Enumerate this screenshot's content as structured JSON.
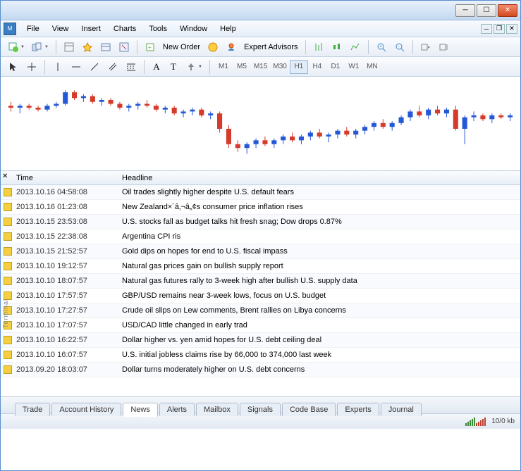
{
  "menu": [
    "File",
    "View",
    "Insert",
    "Charts",
    "Tools",
    "Window",
    "Help"
  ],
  "toolbar_labels": {
    "new_order": "New Order",
    "expert_advisors": "Expert Advisors"
  },
  "timeframes": [
    "M1",
    "M5",
    "M15",
    "M30",
    "H1",
    "H4",
    "D1",
    "W1",
    "MN"
  ],
  "active_timeframe": "H1",
  "news_columns": {
    "time": "Time",
    "headline": "Headline"
  },
  "news": [
    {
      "time": "2013.10.16 04:58:08",
      "headline": "Oil trades slightly higher despite U.S. default fears"
    },
    {
      "time": "2013.10.16 01:23:08",
      "headline": "New Zealand×´â‚¬â„¢s consumer price inflation rises"
    },
    {
      "time": "2013.10.15 23:53:08",
      "headline": "U.S. stocks fall as budget talks hit fresh snag; Dow drops 0.87%"
    },
    {
      "time": "2013.10.15 22:38:08",
      "headline": "Argentina CPI ris"
    },
    {
      "time": "2013.10.15 21:52:57",
      "headline": "Gold dips on hopes for end to U.S. fiscal impass"
    },
    {
      "time": "2013.10.10 19:12:57",
      "headline": "Natural gas prices gain on bullish supply report"
    },
    {
      "time": "2013.10.10 18:07:57",
      "headline": "Natural gas futures rally to 3-week high after bullish U.S. supply data"
    },
    {
      "time": "2013.10.10 17:57:57",
      "headline": "GBP/USD remains near 3-week lows, focus on U.S. budget"
    },
    {
      "time": "2013.10.10 17:27:57",
      "headline": "Crude oil slips on Lew comments, Brent rallies on Libya concerns"
    },
    {
      "time": "2013.10.10 17:07:57",
      "headline": "USD/CAD little changed in early trad"
    },
    {
      "time": "2013.10.10 16:22:57",
      "headline": "Dollar higher vs. yen amid hopes for U.S. debt ceiling deal"
    },
    {
      "time": "2013.10.10 16:07:57",
      "headline": "U.S. initial jobless claims rise by 66,000 to 374,000 last week"
    },
    {
      "time": "2013.09.20 18:03:07",
      "headline": "Dollar turns moderately higher on U.S. debt concerns"
    }
  ],
  "terminal_label": "Terminal",
  "tabs": [
    "Trade",
    "Account History",
    "News",
    "Alerts",
    "Mailbox",
    "Signals",
    "Code Base",
    "Experts",
    "Journal"
  ],
  "active_tab": "News",
  "status": {
    "traffic": "10/0 kb"
  },
  "chart_data": {
    "type": "candlestick",
    "note": "Approximate OHLC candlestick values read from chart pixels; no axes shown.",
    "candles": [
      {
        "o": 50,
        "h": 52,
        "l": 47,
        "c": 49,
        "dir": "down"
      },
      {
        "o": 49,
        "h": 51,
        "l": 46,
        "c": 50,
        "dir": "up"
      },
      {
        "o": 50,
        "h": 51,
        "l": 48,
        "c": 49,
        "dir": "down"
      },
      {
        "o": 49,
        "h": 50,
        "l": 47,
        "c": 48,
        "dir": "down"
      },
      {
        "o": 48,
        "h": 51,
        "l": 47,
        "c": 50,
        "dir": "up"
      },
      {
        "o": 50,
        "h": 52,
        "l": 49,
        "c": 51,
        "dir": "up"
      },
      {
        "o": 51,
        "h": 58,
        "l": 50,
        "c": 57,
        "dir": "up"
      },
      {
        "o": 57,
        "h": 58,
        "l": 53,
        "c": 54,
        "dir": "down"
      },
      {
        "o": 54,
        "h": 56,
        "l": 52,
        "c": 55,
        "dir": "up"
      },
      {
        "o": 55,
        "h": 56,
        "l": 51,
        "c": 52,
        "dir": "down"
      },
      {
        "o": 52,
        "h": 54,
        "l": 50,
        "c": 53,
        "dir": "up"
      },
      {
        "o": 53,
        "h": 54,
        "l": 50,
        "c": 51,
        "dir": "down"
      },
      {
        "o": 51,
        "h": 52,
        "l": 48,
        "c": 49,
        "dir": "down"
      },
      {
        "o": 49,
        "h": 51,
        "l": 47,
        "c": 50,
        "dir": "up"
      },
      {
        "o": 50,
        "h": 52,
        "l": 48,
        "c": 51,
        "dir": "up"
      },
      {
        "o": 51,
        "h": 53,
        "l": 49,
        "c": 50,
        "dir": "down"
      },
      {
        "o": 50,
        "h": 51,
        "l": 47,
        "c": 48,
        "dir": "down"
      },
      {
        "o": 48,
        "h": 50,
        "l": 46,
        "c": 49,
        "dir": "up"
      },
      {
        "o": 49,
        "h": 50,
        "l": 45,
        "c": 46,
        "dir": "down"
      },
      {
        "o": 46,
        "h": 48,
        "l": 44,
        "c": 47,
        "dir": "up"
      },
      {
        "o": 47,
        "h": 49,
        "l": 45,
        "c": 48,
        "dir": "up"
      },
      {
        "o": 48,
        "h": 49,
        "l": 44,
        "c": 45,
        "dir": "down"
      },
      {
        "o": 45,
        "h": 47,
        "l": 43,
        "c": 46,
        "dir": "up"
      },
      {
        "o": 46,
        "h": 47,
        "l": 36,
        "c": 38,
        "dir": "down"
      },
      {
        "o": 38,
        "h": 40,
        "l": 28,
        "c": 30,
        "dir": "down"
      },
      {
        "o": 30,
        "h": 32,
        "l": 26,
        "c": 28,
        "dir": "down"
      },
      {
        "o": 28,
        "h": 31,
        "l": 25,
        "c": 30,
        "dir": "up"
      },
      {
        "o": 30,
        "h": 33,
        "l": 28,
        "c": 32,
        "dir": "up"
      },
      {
        "o": 32,
        "h": 34,
        "l": 29,
        "c": 30,
        "dir": "down"
      },
      {
        "o": 30,
        "h": 33,
        "l": 28,
        "c": 32,
        "dir": "up"
      },
      {
        "o": 32,
        "h": 35,
        "l": 30,
        "c": 34,
        "dir": "up"
      },
      {
        "o": 34,
        "h": 36,
        "l": 31,
        "c": 32,
        "dir": "down"
      },
      {
        "o": 32,
        "h": 35,
        "l": 30,
        "c": 34,
        "dir": "up"
      },
      {
        "o": 34,
        "h": 37,
        "l": 32,
        "c": 36,
        "dir": "up"
      },
      {
        "o": 36,
        "h": 38,
        "l": 33,
        "c": 34,
        "dir": "down"
      },
      {
        "o": 34,
        "h": 36,
        "l": 31,
        "c": 35,
        "dir": "up"
      },
      {
        "o": 35,
        "h": 38,
        "l": 33,
        "c": 37,
        "dir": "up"
      },
      {
        "o": 37,
        "h": 39,
        "l": 34,
        "c": 35,
        "dir": "down"
      },
      {
        "o": 35,
        "h": 38,
        "l": 33,
        "c": 37,
        "dir": "up"
      },
      {
        "o": 37,
        "h": 40,
        "l": 35,
        "c": 39,
        "dir": "up"
      },
      {
        "o": 39,
        "h": 42,
        "l": 37,
        "c": 41,
        "dir": "up"
      },
      {
        "o": 41,
        "h": 43,
        "l": 38,
        "c": 39,
        "dir": "down"
      },
      {
        "o": 39,
        "h": 42,
        "l": 37,
        "c": 41,
        "dir": "up"
      },
      {
        "o": 41,
        "h": 45,
        "l": 40,
        "c": 44,
        "dir": "up"
      },
      {
        "o": 44,
        "h": 48,
        "l": 42,
        "c": 47,
        "dir": "up"
      },
      {
        "o": 47,
        "h": 50,
        "l": 44,
        "c": 45,
        "dir": "down"
      },
      {
        "o": 45,
        "h": 49,
        "l": 43,
        "c": 48,
        "dir": "up"
      },
      {
        "o": 48,
        "h": 50,
        "l": 45,
        "c": 46,
        "dir": "down"
      },
      {
        "o": 46,
        "h": 49,
        "l": 44,
        "c": 48,
        "dir": "up"
      },
      {
        "o": 48,
        "h": 50,
        "l": 37,
        "c": 38,
        "dir": "down"
      },
      {
        "o": 38,
        "h": 45,
        "l": 30,
        "c": 44,
        "dir": "up"
      },
      {
        "o": 44,
        "h": 47,
        "l": 42,
        "c": 45,
        "dir": "up"
      },
      {
        "o": 45,
        "h": 46,
        "l": 42,
        "c": 43,
        "dir": "down"
      },
      {
        "o": 43,
        "h": 46,
        "l": 41,
        "c": 45,
        "dir": "up"
      },
      {
        "o": 45,
        "h": 46,
        "l": 43,
        "c": 44,
        "dir": "down"
      },
      {
        "o": 44,
        "h": 46,
        "l": 42,
        "c": 45,
        "dir": "up"
      }
    ]
  }
}
